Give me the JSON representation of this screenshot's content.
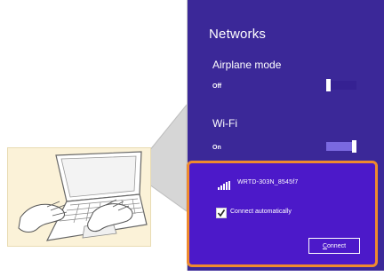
{
  "panel": {
    "title": "Networks",
    "airplane_mode": {
      "label": "Airplane mode",
      "state": "Off",
      "on": false
    },
    "wifi": {
      "label": "Wi-Fi",
      "state": "On",
      "on": true
    }
  },
  "network": {
    "ssid": "WRTD-303N_8545f7",
    "signal_icon": "wifi-signal-bars",
    "connect_automatically": {
      "label": "Connect automatically",
      "checked": true
    },
    "connect_button": {
      "label_accel": "C",
      "label_rest": "onnect"
    }
  },
  "colors": {
    "panel_bg": "#3b2898",
    "highlight_bg": "#4c19c9",
    "highlight_border": "#ef8a2e",
    "illustration_bg": "#fbf2d8"
  }
}
